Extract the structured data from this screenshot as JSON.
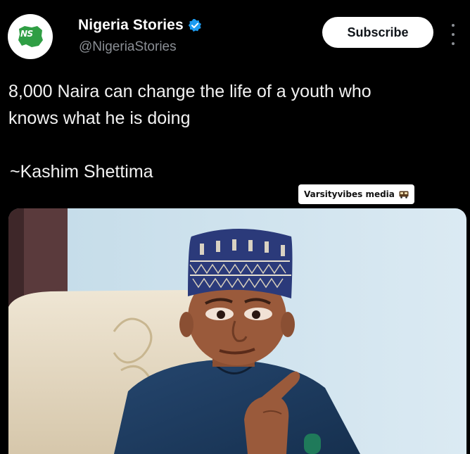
{
  "account": {
    "name": "Nigeria Stories",
    "handle": "@NigeriaStories",
    "avatar_icon": "nigeria-map-logo-icon",
    "avatar_text": "NS",
    "verified_icon": "verified-badge-icon",
    "verified_color": "#1d9bf0"
  },
  "actions": {
    "subscribe_label": "Subscribe",
    "more_icon": "more-vertical-icon"
  },
  "tweet": {
    "text_line1": "8,000 Naira can change the life of a youth who",
    "text_line2": "knows what he is doing",
    "attribution": "~Kashim Shettima"
  },
  "watermark": {
    "text": "Varsityvibes media",
    "icon": "bus-icon"
  },
  "photo": {
    "subject": "man-in-cap-pointing-photo"
  },
  "colors": {
    "background": "#000000",
    "text": "#f2f2f2",
    "secondary_text": "#8b8f95",
    "brand_green": "#1e8a3a"
  }
}
